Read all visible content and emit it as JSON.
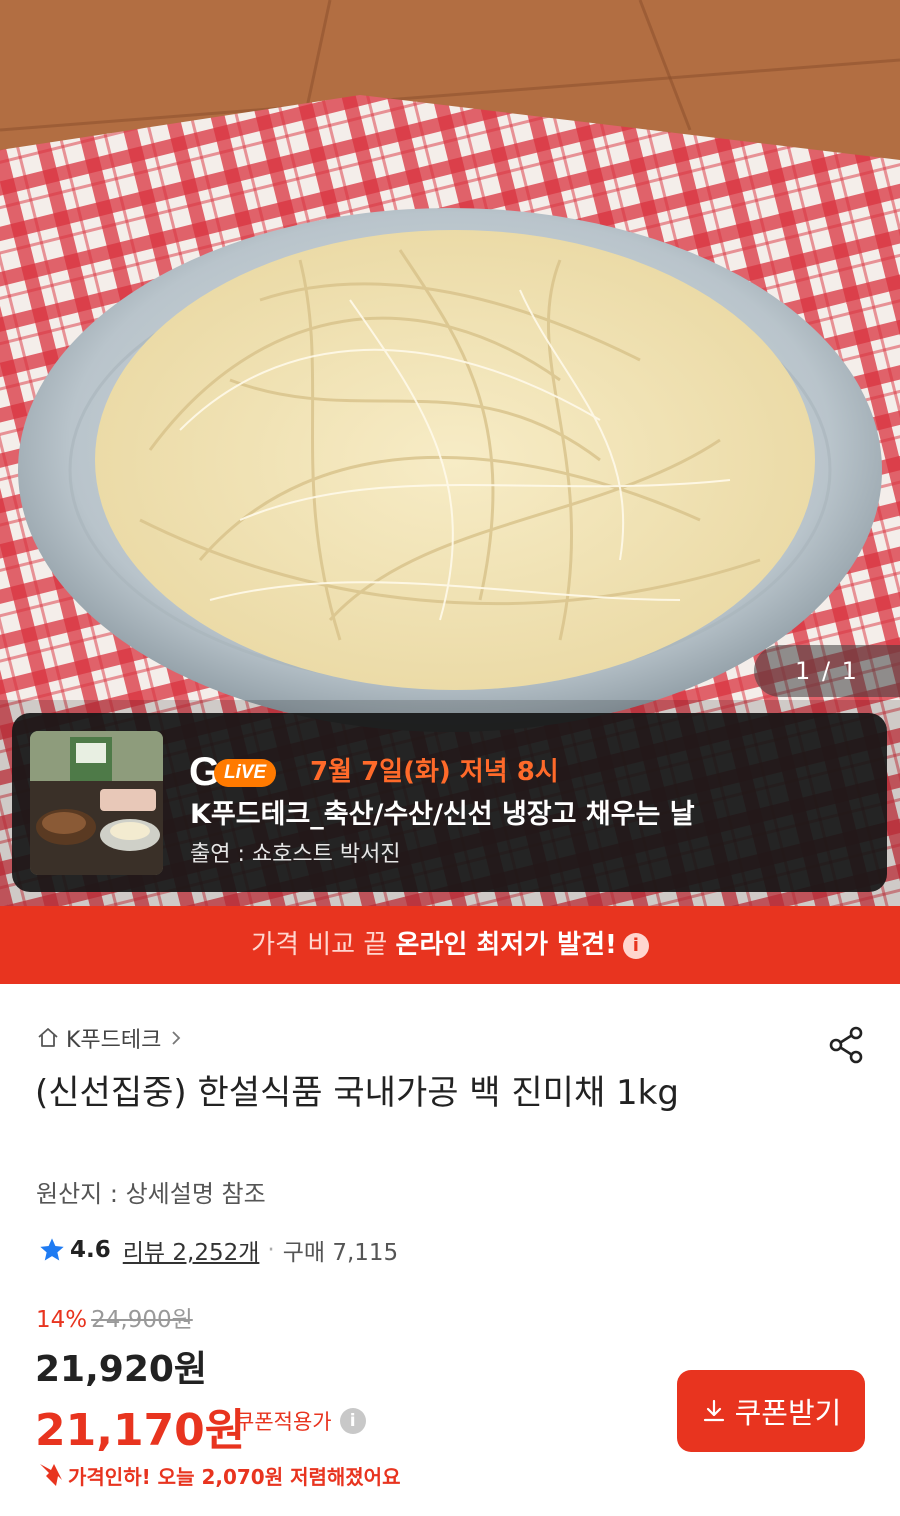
{
  "image": {
    "counter": "1 / 1"
  },
  "live": {
    "logo_letter": "G",
    "logo_badge": "LiVE",
    "date": "7월 7일(화) 저녁 8시",
    "title": "K푸드테크_축산/수산/신선 냉장고 채우는 날",
    "host": "출연 : 쇼호스트 박서진"
  },
  "compare_bar": {
    "prefix": "가격 비교 끝 ",
    "highlight": "온라인 최저가 발견!",
    "info_icon": "i"
  },
  "product": {
    "brand": "K푸드테크",
    "title": "(신선집중) 한설식품 국내가공 백 진미채 1kg",
    "origin": "원산지 : 상세설명 참조",
    "rating": "4.6",
    "review_text": "리뷰 2,252개",
    "purchase_text": "구매 7,115",
    "discount_rate": "14%",
    "original_price": "24,900원",
    "price": "21,920원",
    "coupon_price": "21,170원",
    "coupon_label": "쿠폰적용가",
    "price_drop_note": "가격인하! 오늘 2,070원 저렴해졌어요",
    "coupon_button": "쿠폰받기"
  },
  "colors": {
    "accent": "#e8341f",
    "live_orange": "#ff6a2a"
  },
  "icons": [
    "home-icon",
    "chevron-right-icon",
    "share-icon",
    "star-icon",
    "info-icon",
    "download-icon",
    "price-down-arrow-icon"
  ]
}
